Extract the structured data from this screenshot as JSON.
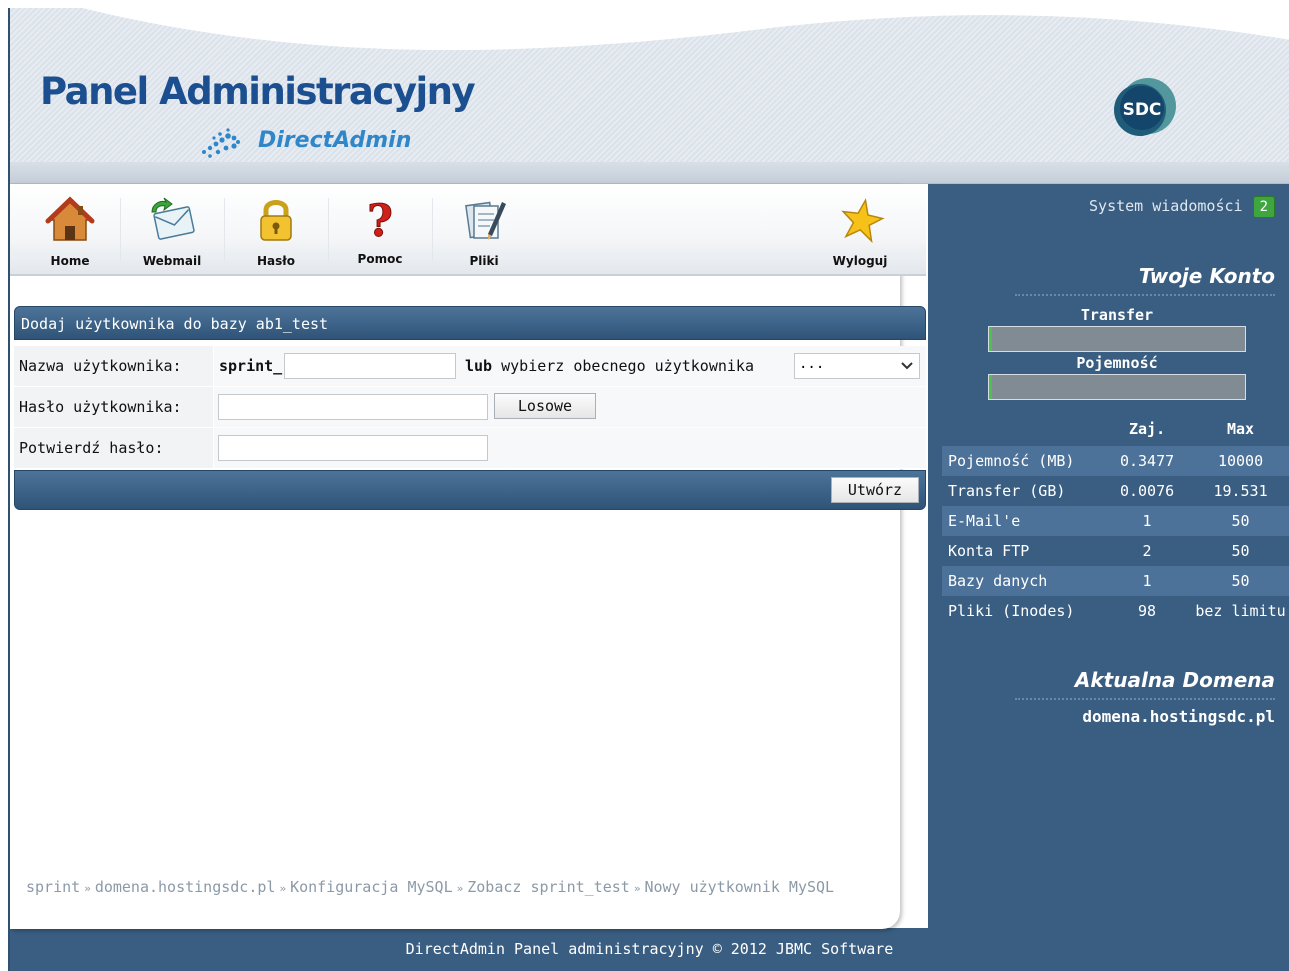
{
  "header": {
    "title": "Panel Administracyjny",
    "subtitle": "DirectAdmin",
    "sdc_logo_text": "SDC"
  },
  "toolbar": {
    "items": [
      {
        "label": "Home",
        "icon": "house-icon"
      },
      {
        "label": "Webmail",
        "icon": "mail-icon"
      },
      {
        "label": "Hasło",
        "icon": "lock-icon"
      },
      {
        "label": "Pomoc",
        "icon": "question-icon"
      },
      {
        "label": "Pliki",
        "icon": "files-icon"
      },
      {
        "label": "Wyloguj",
        "icon": "star-icon"
      }
    ]
  },
  "form": {
    "header": "Dodaj użytkownika do bazy ab1_test",
    "username_label": "Nazwa użytkownika:",
    "username_prefix": "sprint_",
    "username_value": "",
    "or_bold": "lub",
    "or_text": " wybierz obecnego użytkownika",
    "select_value": "...",
    "password_label": "Hasło użytkownika:",
    "password_value": "",
    "random_button": "Losowe",
    "confirm_label": "Potwierdź hasło:",
    "confirm_value": "",
    "create_button": "Utwórz"
  },
  "breadcrumb": [
    "sprint",
    "domena.hostingsdc.pl",
    "Konfiguracja MySQL",
    "Zobacz sprint_test",
    "Nowy użytkownik MySQL"
  ],
  "footer": "DirectAdmin Panel administracyjny © 2012 JBMC Software",
  "sidebar": {
    "system_messages": "System wiadomości",
    "system_messages_count": "2",
    "account_title": "Twoje Konto",
    "transfer_label": "Transfer",
    "transfer_fraction": 0.004,
    "capacity_label": "Pojemność",
    "capacity_fraction": 0.004,
    "col_used": "Zaj.",
    "col_max": "Max",
    "stats": [
      {
        "name": "Pojemność (MB)",
        "used": "0.3477",
        "max": "10000"
      },
      {
        "name": "Transfer (GB)",
        "used": "0.0076",
        "max": "19.531"
      },
      {
        "name": "E-Mail'e",
        "used": "1",
        "max": "50"
      },
      {
        "name": "Konta FTP",
        "used": "2",
        "max": "50"
      },
      {
        "name": "Bazy danych",
        "used": "1",
        "max": "50"
      },
      {
        "name": "Pliki (Inodes)",
        "used": "98",
        "max": "bez limitu"
      }
    ],
    "domain_title": "Aktualna Domena",
    "domain_value": "domena.hostingsdc.pl"
  },
  "colors": {
    "brand_blue": "#1b4f8f",
    "panel_blue": "#3a5e82",
    "badge_green": "#3fa63f"
  }
}
